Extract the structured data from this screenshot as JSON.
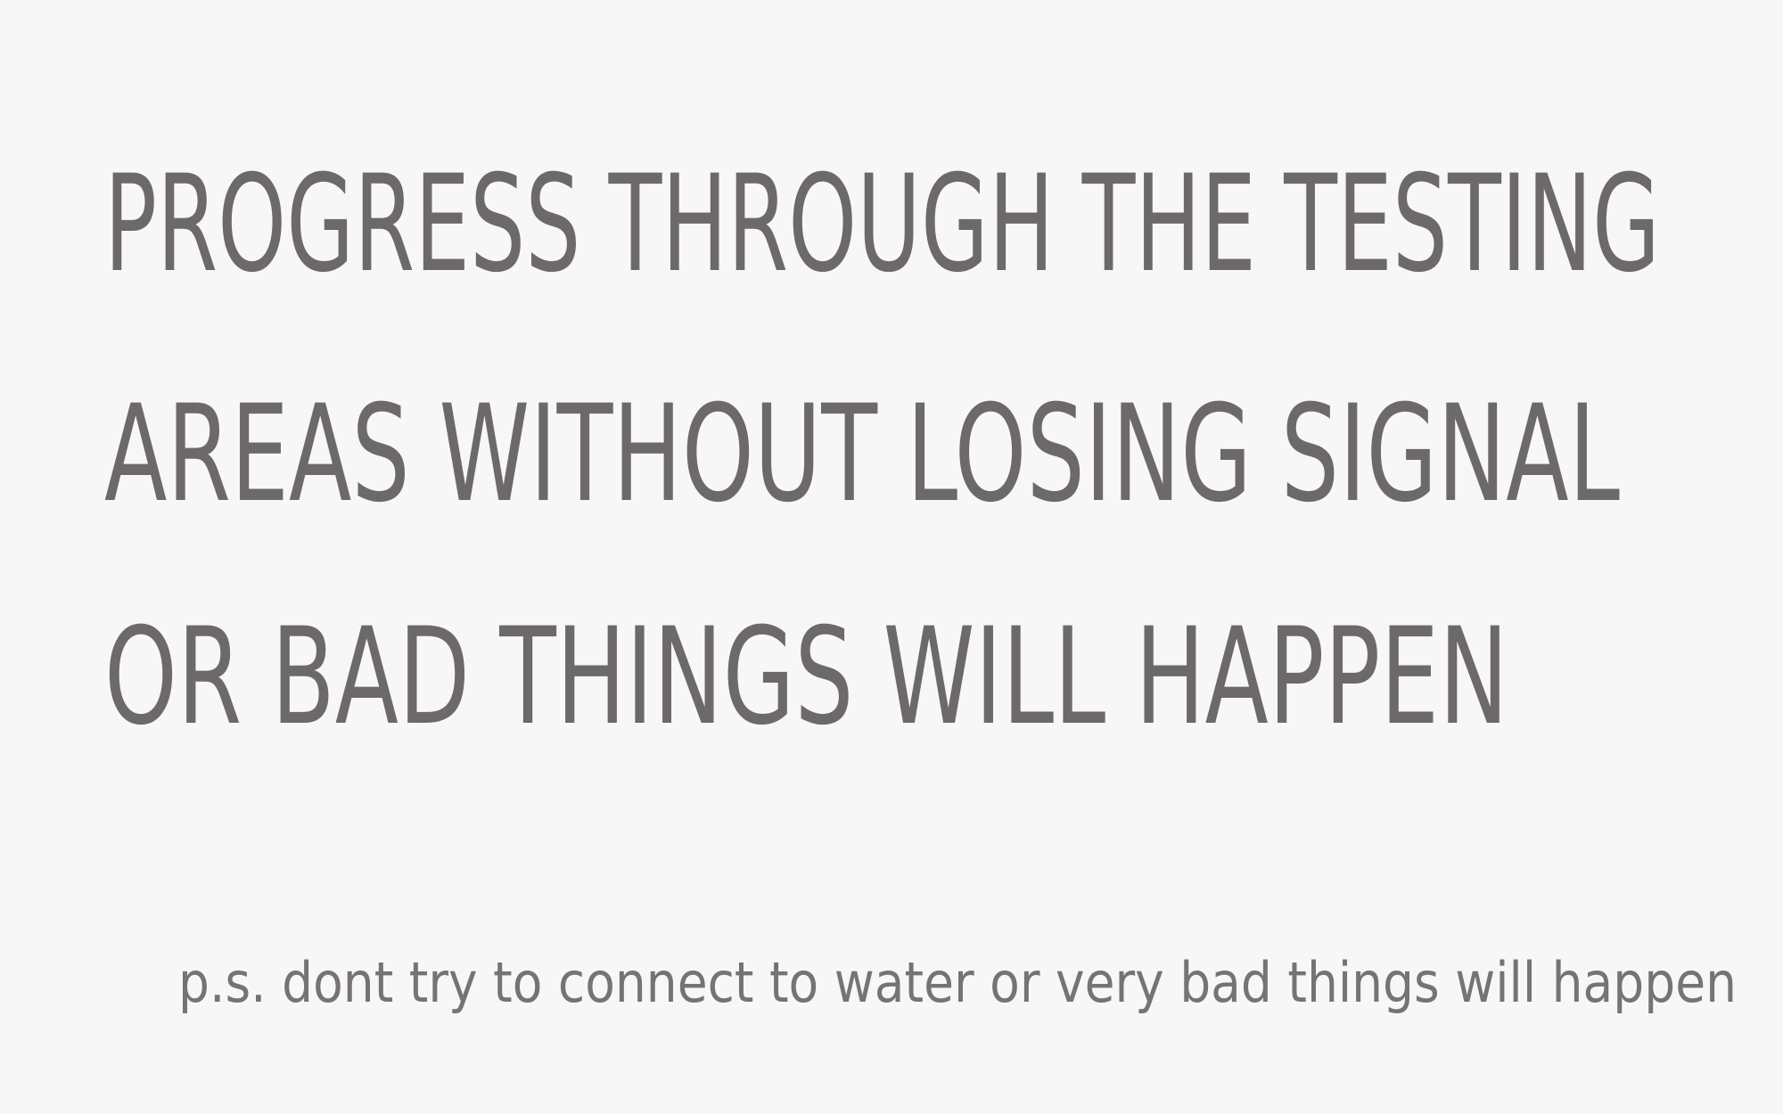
{
  "message": {
    "lines": [
      "PROGRESS THROUGH THE TESTING",
      "AREAS WITHOUT LOSING SIGNAL",
      "OR BAD THINGS WILL HAPPEN"
    ],
    "postscript": "p.s. dont try to connect to water or very bad things will happen"
  },
  "colors": {
    "background": "#f7f7f7",
    "text": "#6d6969"
  }
}
